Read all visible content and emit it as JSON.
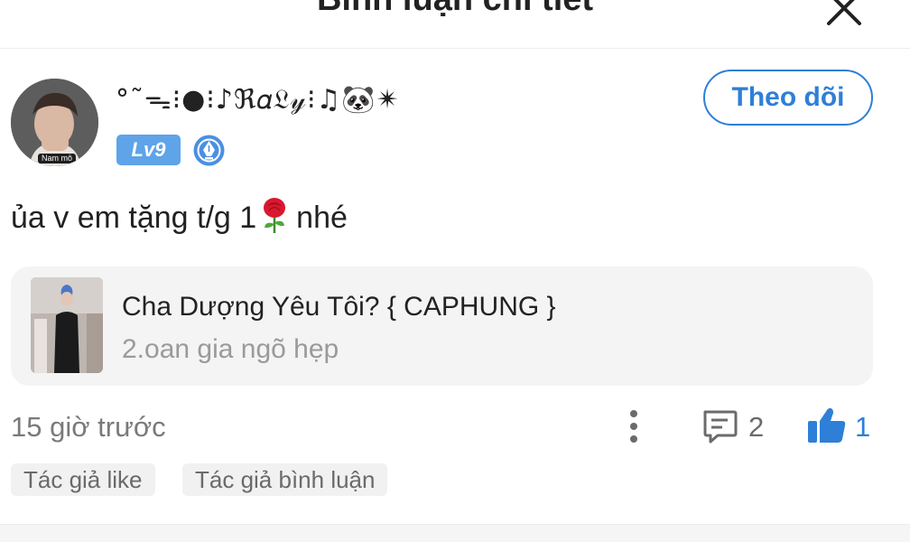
{
  "header": {
    "title": "Bình luận chi tiết",
    "close_icon": "close-icon"
  },
  "author": {
    "avatar_tag": "Nam mô",
    "username": "°˜ᯓ⁝●⁝♪ℜ𝛼𝔏𝓎⁝♫🐼✴",
    "level": "Lv9",
    "badge_icon": "pen-nib-icon",
    "follow_label": "Theo dõi"
  },
  "comment": {
    "text_before": "ủa v em tặng t/g 1",
    "emoji": "rose-icon",
    "text_after": "nhé"
  },
  "book": {
    "title": "Cha Dượng Yêu Tôi? { CAPHUNG }",
    "chapter": "2.oan gia ngõ hẹp"
  },
  "meta": {
    "timestamp": "15 giờ trước",
    "reply_count": "2",
    "like_count": "1"
  },
  "tags": [
    "Tác giả like",
    "Tác giả bình luận"
  ],
  "colors": {
    "accent": "#2e7fd8",
    "level_badge": "#5fa3e8",
    "card_bg": "#f4f4f4"
  }
}
